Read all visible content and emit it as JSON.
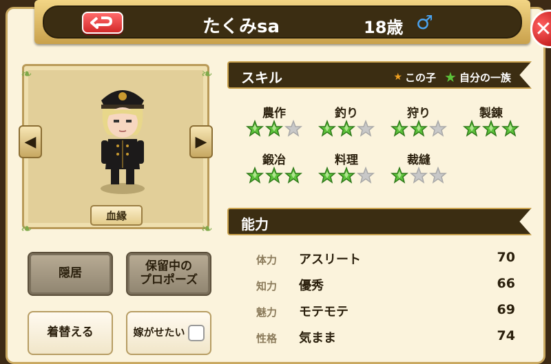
{
  "header": {
    "name": "たくみsa",
    "age": "18歳",
    "gender_symbol": "♂",
    "back_icon": "return-arrow-icon",
    "close_icon": "close-icon"
  },
  "portrait": {
    "lineage_label": "血縁",
    "prev_icon": "◀",
    "next_icon": "▶"
  },
  "actions": {
    "retire_label": "隠居",
    "proposal_label": "保留中の\nプロポーズ",
    "change_clothes_label": "着替える",
    "marry_off_label": "嫁がせたい"
  },
  "skills_section": {
    "title": "スキル",
    "legend_child": "この子",
    "legend_family": "自分の一族",
    "colors": {
      "family_star": "#5cc23a",
      "child_star": "#f0a020",
      "empty_star": "#c8c8c8"
    },
    "skills": [
      {
        "name": "農作",
        "stars": 2
      },
      {
        "name": "釣り",
        "stars": 2
      },
      {
        "name": "狩り",
        "stars": 2
      },
      {
        "name": "製錬",
        "stars": 3
      },
      {
        "name": "鍛冶",
        "stars": 3
      },
      {
        "name": "料理",
        "stars": 2
      },
      {
        "name": "裁縫",
        "stars": 1
      }
    ]
  },
  "abilities_section": {
    "title": "能力",
    "rows": [
      {
        "label": "体力",
        "value": "アスリート",
        "number": "70"
      },
      {
        "label": "知力",
        "value": "優秀",
        "number": "66"
      },
      {
        "label": "魅力",
        "value": "モテモテ",
        "number": "69"
      },
      {
        "label": "性格",
        "value": "気まま",
        "number": "74"
      }
    ]
  }
}
